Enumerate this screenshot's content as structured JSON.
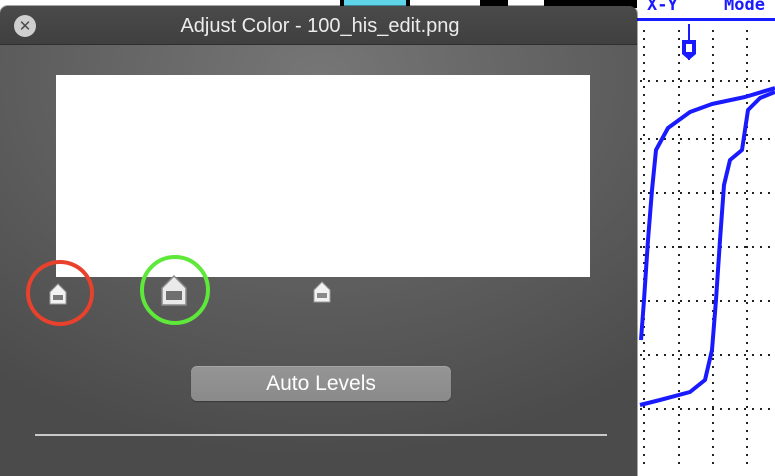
{
  "window": {
    "title": "Adjust Color - 100_his_edit.png",
    "close_glyph": "✕"
  },
  "levels": {
    "black_point_slider": "slider-handle-icon",
    "midtone_slider": "slider-handle-icon",
    "white_point_slider": "slider-handle-icon",
    "black_point_highlight_color": "#e8412c",
    "midtone_highlight_color": "#5ee83a",
    "auto_levels_label": "Auto Levels"
  },
  "background": {
    "xy_label": "X-Y",
    "mode_label": "Mode",
    "trace_color": "#1a1aff"
  }
}
